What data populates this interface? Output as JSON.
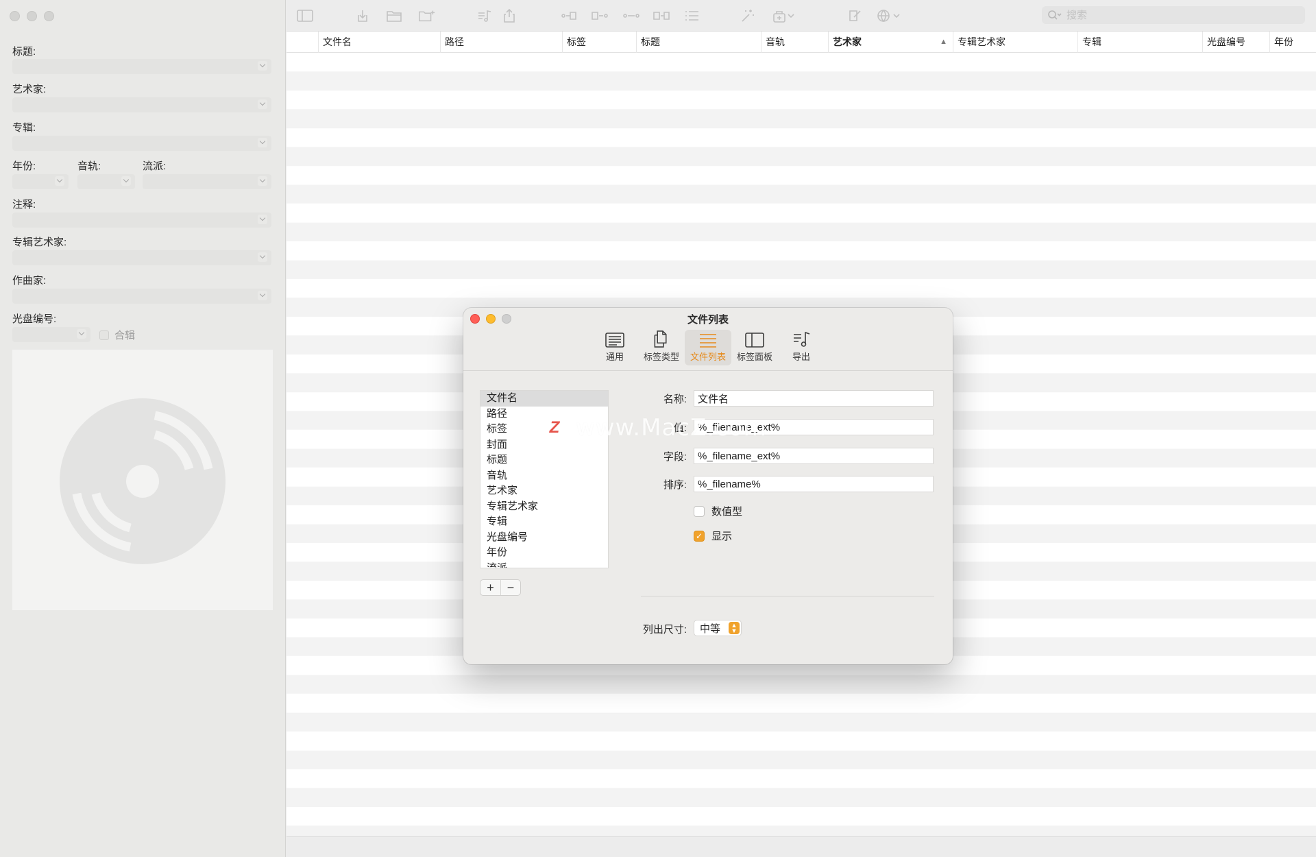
{
  "sidebar": {
    "fields": {
      "title": "标题:",
      "artist": "艺术家:",
      "album": "专辑:",
      "year": "年份:",
      "track": "音轨:",
      "genre": "流派:",
      "comment": "注释:",
      "album_artist": "专辑艺术家:",
      "composer": "作曲家:",
      "disc_number": "光盘编号:",
      "compilation": "合辑"
    }
  },
  "toolbar": {
    "search_placeholder": "搜索"
  },
  "table": {
    "columns": [
      "文件名",
      "路径",
      "标签",
      "标题",
      "音轨",
      "艺术家",
      "专辑艺术家",
      "专辑",
      "光盘编号",
      "年份"
    ],
    "sorted_column": "艺术家"
  },
  "dialog": {
    "title": "文件列表",
    "tabs": [
      {
        "label": "通用",
        "icon": "general-icon"
      },
      {
        "label": "标签类型",
        "icon": "tag-types-icon"
      },
      {
        "label": "文件列表",
        "icon": "file-list-icon"
      },
      {
        "label": "标签面板",
        "icon": "tag-panel-icon"
      },
      {
        "label": "导出",
        "icon": "export-icon"
      }
    ],
    "active_tab": "文件列表",
    "column_list": [
      "文件名",
      "路径",
      "标签",
      "封面",
      "标题",
      "音轨",
      "艺术家",
      "专辑艺术家",
      "专辑",
      "光盘编号",
      "年份",
      "流派"
    ],
    "selected_column": "文件名",
    "form": {
      "name_label": "名称:",
      "name_value": "文件名",
      "value_label": "值:",
      "value_value": "%_filename_ext%",
      "field_label": "字段:",
      "field_value": "%_filename_ext%",
      "sort_label": "排序:",
      "sort_value": "%_filename%",
      "numeric_label": "数值型",
      "numeric_checked": false,
      "visible_label": "显示",
      "visible_checked": true,
      "size_label": "列出尺寸:",
      "size_value": "中等"
    },
    "add_button": "+",
    "remove_button": "−"
  },
  "watermark": {
    "logo": "Z",
    "text": "www.MacZ.com"
  },
  "colors": {
    "accent": "#e68a1a",
    "checkbox": "#f0a22c",
    "close": "#ff5f57",
    "minimize": "#febc2e"
  }
}
